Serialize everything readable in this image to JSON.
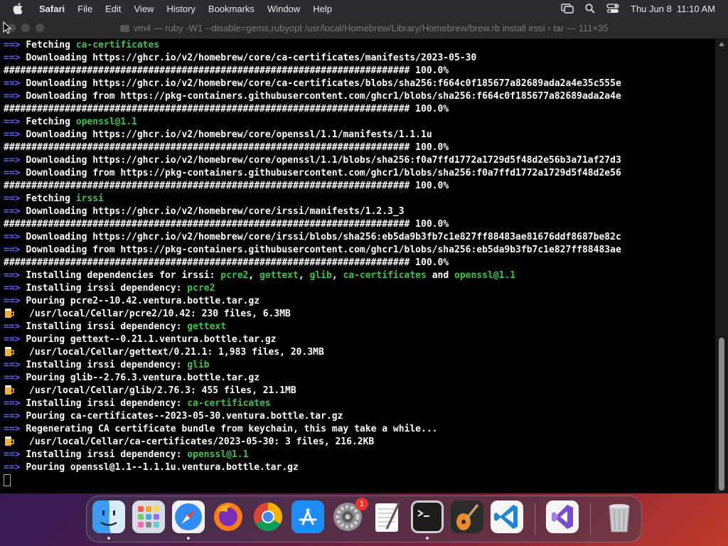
{
  "menubar": {
    "app": "Safari",
    "items": [
      "File",
      "Edit",
      "View",
      "History",
      "Bookmarks",
      "Window",
      "Help"
    ],
    "clock": "Thu Jun 8  11:10 AM",
    "icons": [
      "apple-icon",
      "screen-mirror-icon",
      "search-icon",
      "control-center-icon"
    ]
  },
  "terminal": {
    "title": "vm4 — ruby -W1 --disable=gems,rubyopt /usr/local/Homebrew/Library/Homebrew/brew.rb install irssi › tar — 111×35",
    "colors": {
      "arrow": "#5b63f2",
      "highlight": "#3cc34a",
      "text": "#ffffff",
      "background": "#000000"
    },
    "lines": [
      {
        "type": "arrow",
        "parts": [
          {
            "t": "Fetching "
          },
          {
            "t": "ca-certificates",
            "g": true
          }
        ]
      },
      {
        "type": "arrow",
        "parts": [
          {
            "t": "Downloading https://ghcr.io/v2/homebrew/core/ca-certificates/manifests/2023-05-30"
          }
        ]
      },
      {
        "type": "plain",
        "parts": [
          {
            "t": "######################################################################### 100.0%"
          }
        ]
      },
      {
        "type": "arrow",
        "parts": [
          {
            "t": "Downloading https://ghcr.io/v2/homebrew/core/ca-certificates/blobs/sha256:f664c0f185677a82689ada2a4e35c555e"
          }
        ]
      },
      {
        "type": "arrow",
        "parts": [
          {
            "t": "Downloading from https://pkg-containers.githubusercontent.com/ghcr1/blobs/sha256:f664c0f185677a82689ada2a4e"
          }
        ]
      },
      {
        "type": "plain",
        "parts": [
          {
            "t": "######################################################################### 100.0%"
          }
        ]
      },
      {
        "type": "arrow",
        "parts": [
          {
            "t": "Fetching "
          },
          {
            "t": "openssl@1.1",
            "g": true
          }
        ]
      },
      {
        "type": "arrow",
        "parts": [
          {
            "t": "Downloading https://ghcr.io/v2/homebrew/core/openssl/1.1/manifests/1.1.1u"
          }
        ]
      },
      {
        "type": "plain",
        "parts": [
          {
            "t": "######################################################################### 100.0%"
          }
        ]
      },
      {
        "type": "arrow",
        "parts": [
          {
            "t": "Downloading https://ghcr.io/v2/homebrew/core/openssl/1.1/blobs/sha256:f0a7ffd1772a1729d5f48d2e56b3a71af27d3"
          }
        ]
      },
      {
        "type": "arrow",
        "parts": [
          {
            "t": "Downloading from https://pkg-containers.githubusercontent.com/ghcr1/blobs/sha256:f0a7ffd1772a1729d5f48d2e56"
          }
        ]
      },
      {
        "type": "plain",
        "parts": [
          {
            "t": "######################################################################### 100.0%"
          }
        ]
      },
      {
        "type": "arrow",
        "parts": [
          {
            "t": "Fetching "
          },
          {
            "t": "irssi",
            "g": true
          }
        ]
      },
      {
        "type": "arrow",
        "parts": [
          {
            "t": "Downloading https://ghcr.io/v2/homebrew/core/irssi/manifests/1.2.3_3"
          }
        ]
      },
      {
        "type": "plain",
        "parts": [
          {
            "t": "######################################################################### 100.0%"
          }
        ]
      },
      {
        "type": "arrow",
        "parts": [
          {
            "t": "Downloading https://ghcr.io/v2/homebrew/core/irssi/blobs/sha256:eb5da9b3fb7c1e827ff88483ae81676ddf8687be82c"
          }
        ]
      },
      {
        "type": "arrow",
        "parts": [
          {
            "t": "Downloading from https://pkg-containers.githubusercontent.com/ghcr1/blobs/sha256:eb5da9b3fb7c1e827ff88483ae"
          }
        ]
      },
      {
        "type": "plain",
        "parts": [
          {
            "t": "######################################################################### 100.0%"
          }
        ]
      },
      {
        "type": "arrow",
        "parts": [
          {
            "t": "Installing dependencies for irssi: "
          },
          {
            "t": "pcre2",
            "g": true
          },
          {
            "t": ", "
          },
          {
            "t": "gettext",
            "g": true
          },
          {
            "t": ", "
          },
          {
            "t": "glib",
            "g": true
          },
          {
            "t": ", "
          },
          {
            "t": "ca-certificates",
            "g": true
          },
          {
            "t": " and "
          },
          {
            "t": "openssl@1.1",
            "g": true
          }
        ]
      },
      {
        "type": "arrow",
        "parts": [
          {
            "t": "Installing irssi dependency: "
          },
          {
            "t": "pcre2",
            "g": true
          }
        ]
      },
      {
        "type": "arrow",
        "parts": [
          {
            "t": "Pouring pcre2--10.42.ventura.bottle.tar.gz"
          }
        ]
      },
      {
        "type": "beer",
        "parts": [
          {
            "t": "/usr/local/Cellar/pcre2/10.42: 230 files, 6.3MB"
          }
        ]
      },
      {
        "type": "arrow",
        "parts": [
          {
            "t": "Installing irssi dependency: "
          },
          {
            "t": "gettext",
            "g": true
          }
        ]
      },
      {
        "type": "arrow",
        "parts": [
          {
            "t": "Pouring gettext--0.21.1.ventura.bottle.tar.gz"
          }
        ]
      },
      {
        "type": "beer",
        "parts": [
          {
            "t": "/usr/local/Cellar/gettext/0.21.1: 1,983 files, 20.3MB"
          }
        ]
      },
      {
        "type": "arrow",
        "parts": [
          {
            "t": "Installing irssi dependency: "
          },
          {
            "t": "glib",
            "g": true
          }
        ]
      },
      {
        "type": "arrow",
        "parts": [
          {
            "t": "Pouring glib--2.76.3.ventura.bottle.tar.gz"
          }
        ]
      },
      {
        "type": "beer",
        "parts": [
          {
            "t": "/usr/local/Cellar/glib/2.76.3: 455 files, 21.1MB"
          }
        ]
      },
      {
        "type": "arrow",
        "parts": [
          {
            "t": "Installing irssi dependency: "
          },
          {
            "t": "ca-certificates",
            "g": true
          }
        ]
      },
      {
        "type": "arrow",
        "parts": [
          {
            "t": "Pouring ca-certificates--2023-05-30.ventura.bottle.tar.gz"
          }
        ]
      },
      {
        "type": "arrow",
        "parts": [
          {
            "t": "Regenerating CA certificate bundle from keychain, this may take a while..."
          }
        ]
      },
      {
        "type": "beer",
        "parts": [
          {
            "t": "/usr/local/Cellar/ca-certificates/2023-05-30: 3 files, 216.2KB"
          }
        ]
      },
      {
        "type": "arrow",
        "parts": [
          {
            "t": "Installing irssi dependency: "
          },
          {
            "t": "openssl@1.1",
            "g": true
          }
        ]
      },
      {
        "type": "arrow",
        "parts": [
          {
            "t": "Pouring openssl@1.1--1.1.1u.ventura.bottle.tar.gz"
          }
        ]
      },
      {
        "type": "cursor",
        "parts": []
      }
    ],
    "arrow_glyph": "==> "
  },
  "dock": {
    "apps": [
      {
        "name": "finder",
        "icon": "finder-icon",
        "running": true
      },
      {
        "name": "launchpad",
        "icon": "launchpad-icon",
        "running": false
      },
      {
        "name": "safari",
        "icon": "safari-icon",
        "running": true
      },
      {
        "name": "firefox",
        "icon": "firefox-icon",
        "running": false
      },
      {
        "name": "chrome",
        "icon": "chrome-icon",
        "running": false
      },
      {
        "name": "app-store",
        "icon": "app-store-icon",
        "running": false
      },
      {
        "name": "system-settings",
        "icon": "gear-icon",
        "running": false,
        "badge": "1"
      },
      {
        "name": "textedit",
        "icon": "textedit-icon",
        "running": false
      },
      {
        "name": "terminal",
        "icon": "terminal-icon",
        "running": true
      },
      {
        "name": "garageband",
        "icon": "guitar-icon",
        "running": false
      },
      {
        "name": "vscode",
        "icon": "vscode-icon",
        "running": false
      },
      {
        "name": "visual-studio",
        "icon": "visual-studio-icon",
        "running": false
      },
      {
        "name": "trash",
        "icon": "trash-icon",
        "running": false
      }
    ]
  }
}
